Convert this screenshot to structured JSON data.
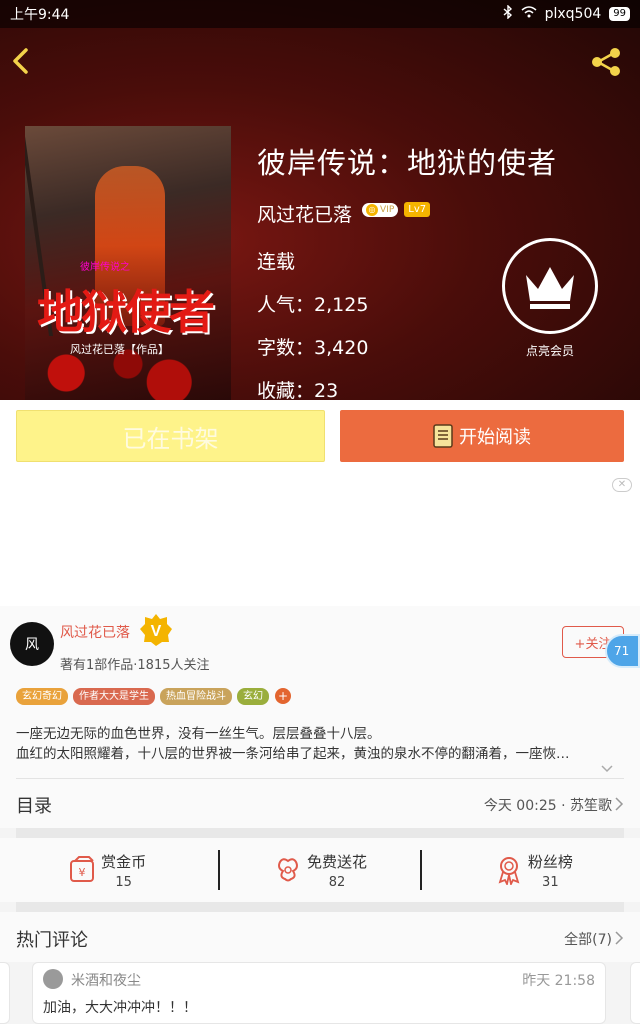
{
  "status_bar": {
    "time": "上午9:44",
    "network": "plxq504",
    "battery": "99"
  },
  "book": {
    "title": "彼岸传说：地狱的使者",
    "author": "风过花已落",
    "vip_label": "VIP",
    "level": "Lv7",
    "status": "连载",
    "popularity_label": "人气：",
    "popularity": "2,125",
    "words_label": "字数：",
    "words": "3,420",
    "favorites_label": "收藏：",
    "favorites": "23",
    "cover_title": "地狱使者",
    "cover_subtitle": "彼岸传说之",
    "cover_author": "风过花已落【作品】"
  },
  "member": {
    "label": "点亮会员"
  },
  "actions": {
    "shelf_label": "已在书架",
    "read_label": "开始阅读"
  },
  "ad": {
    "close_label": "✕"
  },
  "author_card": {
    "avatar_text": "风",
    "name": "风过花已落",
    "verified_mark": "V",
    "meta": "著有1部作品·1815人关注",
    "follow_label": "+关注",
    "float_count": "71",
    "tags": [
      {
        "label": "玄幻奇幻",
        "color": "#e9a23b"
      },
      {
        "label": "作者大大是学生",
        "color": "#d9694f"
      },
      {
        "label": "热血冒险战斗",
        "color": "#c9a35b"
      },
      {
        "label": "玄幻",
        "color": "#9aae3c"
      }
    ],
    "tag_more": "+",
    "intro_line1": "一座无边无际的血色世界，没有一丝生气。层层叠叠十八层。",
    "intro_line2": "血红的太阳照耀着，十八层的世界被一条河给串了起来，黄浊的泉水不停的翻涌着，一座恢…"
  },
  "toc": {
    "title": "目录",
    "latest": "今天 00:25 · 苏笙歌"
  },
  "stats": [
    {
      "label": "赏金币",
      "value": "15",
      "icon": "coin-icon"
    },
    {
      "label": "免费送花",
      "value": "82",
      "icon": "flower-icon"
    },
    {
      "label": "粉丝榜",
      "value": "31",
      "icon": "medal-icon"
    }
  ],
  "comments": {
    "title": "热门评论",
    "all_label": "全部(7)",
    "items": [
      {
        "user": "米酒和夜尘",
        "time": "昨天 21:58",
        "text": "加油，大大冲冲冲！！！"
      }
    ]
  },
  "colors": {
    "accent_orange": "#ec6b3f",
    "shelf_yellow": "#fef38a",
    "author_red": "#e05a4a",
    "badge_blue": "#4ea5e8"
  }
}
